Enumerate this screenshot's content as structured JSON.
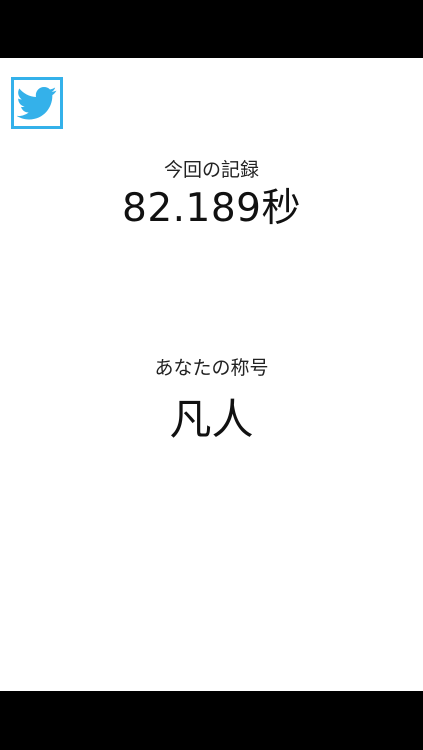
{
  "colors": {
    "background": "#ffffff",
    "letterbox": "#000000",
    "twitter_accent": "#34b1ea",
    "text": "#111111"
  },
  "share": {
    "icon": "twitter-bird-icon"
  },
  "result": {
    "record_label": "今回の記録",
    "record_value": "82.189秒",
    "title_label": "あなたの称号",
    "title_value": "凡人"
  }
}
